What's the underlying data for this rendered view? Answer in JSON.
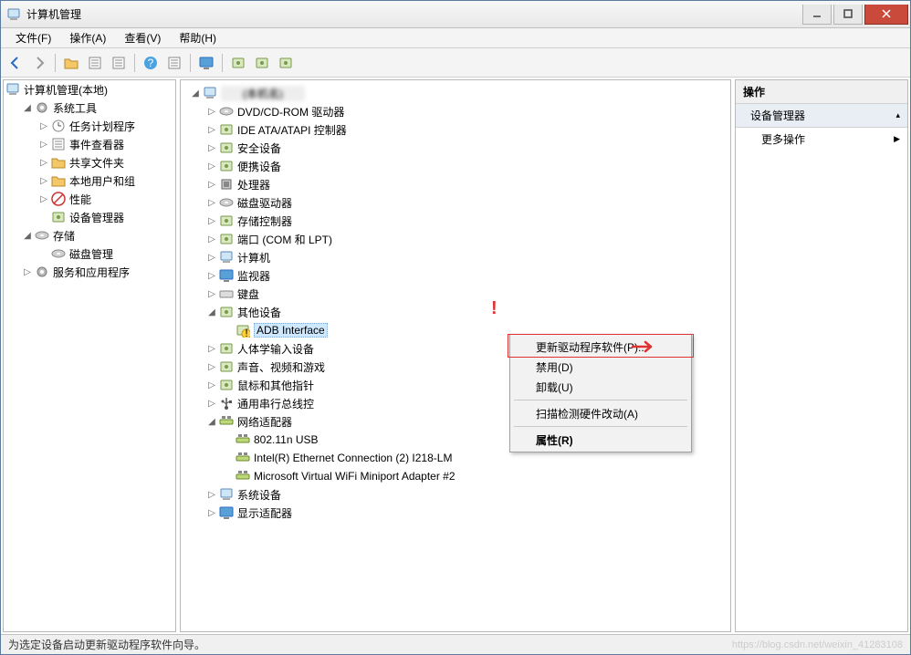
{
  "title": "计算机管理",
  "menus": {
    "file": "文件(F)",
    "action": "操作(A)",
    "view": "查看(V)",
    "help": "帮助(H)"
  },
  "statusbar": "为选定设备启动更新驱动程序软件向导。",
  "watermark": "https://blog.csdn.net/weixin_41283108",
  "left_tree": {
    "root": "计算机管理(本地)",
    "sys_tools": "系统工具",
    "task_scheduler": "任务计划程序",
    "event_viewer": "事件查看器",
    "shared_folders": "共享文件夹",
    "local_users": "本地用户和组",
    "performance": "性能",
    "device_manager": "设备管理器",
    "storage": "存储",
    "disk_mgmt": "磁盘管理",
    "services_apps": "服务和应用程序"
  },
  "dev_tree": {
    "root": "(本机名)",
    "dvd": "DVD/CD-ROM 驱动器",
    "ide": "IDE ATA/ATAPI 控制器",
    "security": "安全设备",
    "portable": "便携设备",
    "cpu": "处理器",
    "disk": "磁盘驱动器",
    "storage_ctrl": "存储控制器",
    "ports": "端口 (COM 和 LPT)",
    "computer": "计算机",
    "monitor": "监视器",
    "keyboard": "键盘",
    "other": "其他设备",
    "adb": "ADB Interface",
    "hid": "人体学输入设备",
    "sound": "声音、视频和游戏",
    "mouse": "鼠标和其他指针",
    "usb": "通用串行总线控",
    "netadapter": "网络适配器",
    "net1": "802.11n USB",
    "net2": "Intel(R) Ethernet Connection (2) I218-LM",
    "net3": "Microsoft Virtual WiFi Miniport Adapter #2",
    "sysdev": "系统设备",
    "display": "显示适配器"
  },
  "context_menu": {
    "update": "更新驱动程序软件(P)...",
    "disable": "禁用(D)",
    "uninstall": "卸载(U)",
    "scan": "扫描检测硬件改动(A)",
    "properties": "属性(R)"
  },
  "actions_pane": {
    "header": "操作",
    "subheader": "设备管理器",
    "more": "更多操作"
  }
}
